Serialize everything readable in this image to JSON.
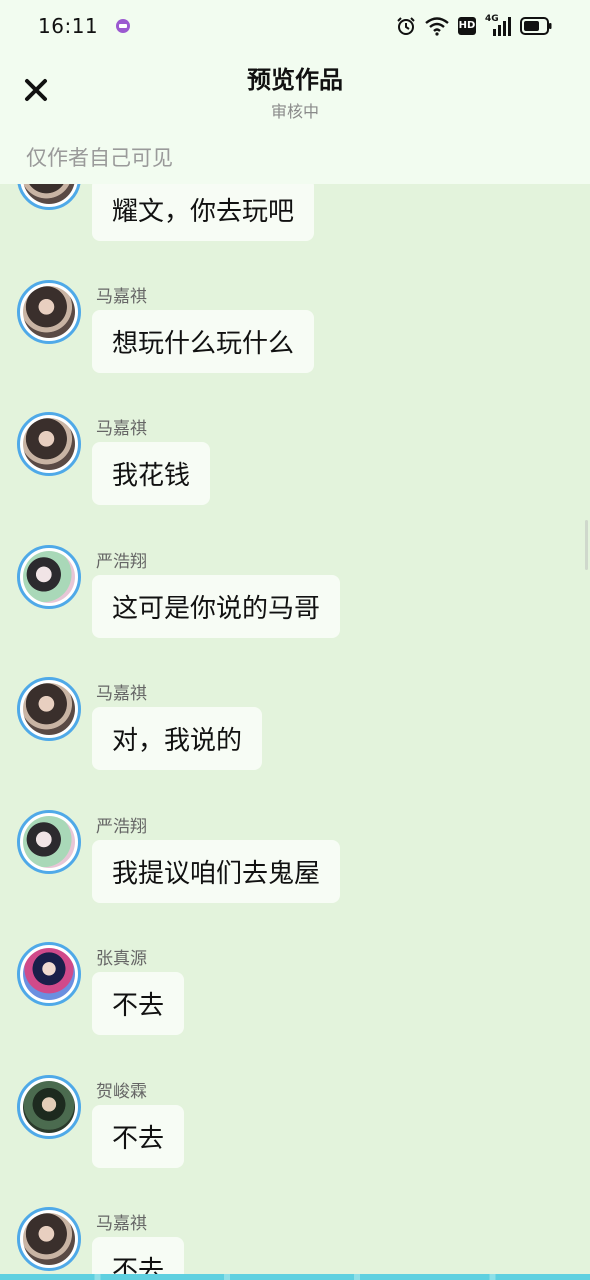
{
  "status_bar": {
    "time": "16:11",
    "icons": [
      "app-notification-icon",
      "alarm-icon",
      "wifi-icon",
      "hd-icon",
      "4g-signal-icon",
      "battery-icon"
    ],
    "hd_label": "HD",
    "network_label": "4G"
  },
  "header": {
    "close_icon": "close-icon",
    "title": "预览作品",
    "subtitle": "审核中",
    "visibility_note": "仅作者自己可见"
  },
  "messages": [
    {
      "sender": "",
      "text": "耀文，你去玩吧",
      "avatar": "avatar-ma-jiaqi"
    },
    {
      "sender": "马嘉祺",
      "text": "想玩什么玩什么",
      "avatar": "avatar-ma-jiaqi"
    },
    {
      "sender": "马嘉祺",
      "text": "我花钱",
      "avatar": "avatar-ma-jiaqi"
    },
    {
      "sender": "严浩翔",
      "text": "这可是你说的马哥",
      "avatar": "avatar-yan-haoxiang"
    },
    {
      "sender": "马嘉祺",
      "text": "对，我说的",
      "avatar": "avatar-ma-jiaqi"
    },
    {
      "sender": "严浩翔",
      "text": "我提议咱们去鬼屋",
      "avatar": "avatar-yan-haoxiang"
    },
    {
      "sender": "张真源",
      "text": "不去",
      "avatar": "avatar-zhang-zhenyuan"
    },
    {
      "sender": "贺峻霖",
      "text": "不去",
      "avatar": "avatar-he-junlin"
    },
    {
      "sender": "马嘉祺",
      "text": "不去",
      "avatar": "avatar-ma-jiaqi"
    }
  ]
}
